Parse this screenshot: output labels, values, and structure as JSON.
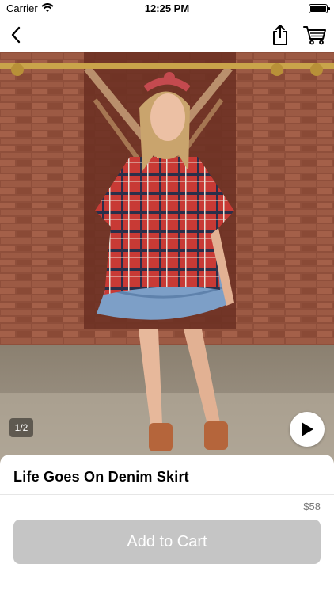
{
  "status_bar": {
    "carrier": "Carrier",
    "time": "12:25 PM"
  },
  "nav": {
    "icons": [
      "chevron-left-icon",
      "share-icon",
      "cart-icon"
    ]
  },
  "gallery": {
    "page_indicator": "1/2",
    "play_icon": "play-icon"
  },
  "product": {
    "title": "Life Goes On Denim Skirt",
    "price": "$58"
  },
  "actions": {
    "add_to_cart_label": "Add to Cart"
  },
  "colors": {
    "button_disabled": "#c5c5c5",
    "price_text": "#777777"
  }
}
